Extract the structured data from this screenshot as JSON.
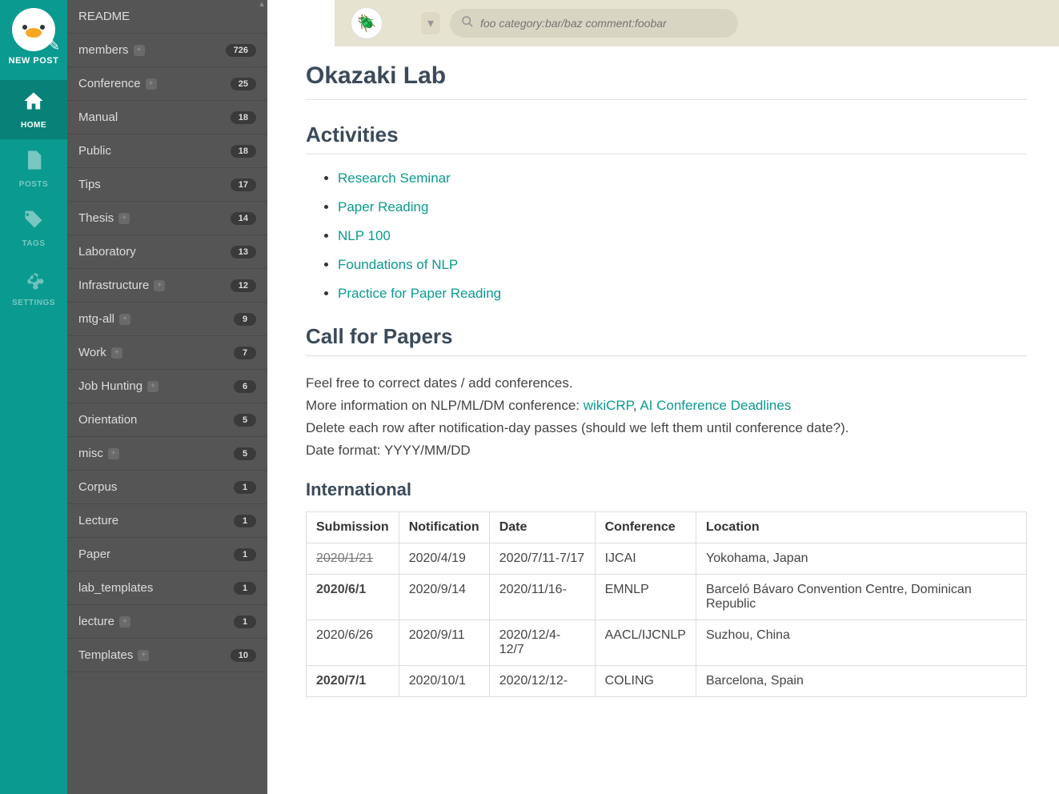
{
  "nav": {
    "new_post": "NEW POST",
    "items": [
      {
        "label": "HOME",
        "icon": "home",
        "active": true
      },
      {
        "label": "POSTS",
        "icon": "file",
        "active": false
      },
      {
        "label": "TAGS",
        "icon": "tags",
        "active": false
      },
      {
        "label": "SETTINGS",
        "icon": "gear",
        "active": false
      }
    ]
  },
  "search": {
    "placeholder": "foo category:bar/baz comment:foobar"
  },
  "categories": [
    {
      "name": "README",
      "count": null,
      "plus": false
    },
    {
      "name": "members",
      "count": "726",
      "plus": true
    },
    {
      "name": "Conference",
      "count": "25",
      "plus": true
    },
    {
      "name": "Manual",
      "count": "18",
      "plus": false
    },
    {
      "name": "Public",
      "count": "18",
      "plus": false
    },
    {
      "name": "Tips",
      "count": "17",
      "plus": false
    },
    {
      "name": "Thesis",
      "count": "14",
      "plus": true
    },
    {
      "name": "Laboratory",
      "count": "13",
      "plus": false
    },
    {
      "name": "Infrastructure",
      "count": "12",
      "plus": true
    },
    {
      "name": "mtg-all",
      "count": "9",
      "plus": true
    },
    {
      "name": "Work",
      "count": "7",
      "plus": true
    },
    {
      "name": "Job Hunting",
      "count": "6",
      "plus": true
    },
    {
      "name": "Orientation",
      "count": "5",
      "plus": false
    },
    {
      "name": "misc",
      "count": "5",
      "plus": true
    },
    {
      "name": "Corpus",
      "count": "1",
      "plus": false
    },
    {
      "name": "Lecture",
      "count": "1",
      "plus": false
    },
    {
      "name": "Paper",
      "count": "1",
      "plus": false
    },
    {
      "name": "lab_templates",
      "count": "1",
      "plus": false
    },
    {
      "name": "lecture",
      "count": "1",
      "plus": true
    },
    {
      "name": "Templates",
      "count": "10",
      "plus": true
    }
  ],
  "page": {
    "title": "Okazaki Lab",
    "activities_heading": "Activities",
    "activities": [
      "Research Seminar",
      "Paper Reading",
      "NLP 100",
      "Foundations of NLP",
      "Practice for Paper Reading"
    ],
    "cfp_heading": "Call for Papers",
    "cfp_line1": "Feel free to correct dates / add conferences.",
    "cfp_line2_a": "More information on NLP/ML/DM conference: ",
    "cfp_link1": "wikiCRP",
    "cfp_sep": ", ",
    "cfp_link2": "AI Conference Deadlines",
    "cfp_line3": "Delete each row after notification-day passes (should we left them until conference date?).",
    "cfp_line4": "Date format: YYYY/MM/DD",
    "intl_heading": "International",
    "table": {
      "headers": [
        "Submission",
        "Notification",
        "Date",
        "Conference",
        "Location"
      ],
      "rows": [
        {
          "submission": "2020/1/21",
          "sub_style": "strike",
          "notification": "2020/4/19",
          "date": "2020/7/11-7/17",
          "conf": "IJCAI",
          "loc": "Yokohama, Japan"
        },
        {
          "submission": "2020/6/1",
          "sub_style": "bold",
          "notification": "2020/9/14",
          "date": "2020/11/16-",
          "conf": "EMNLP",
          "loc": "Barceló Bávaro Convention Centre, Dominican Republic"
        },
        {
          "submission": "2020/6/26",
          "sub_style": "",
          "notification": "2020/9/11",
          "date": "2020/12/4-12/7",
          "conf": "AACL/IJCNLP",
          "loc": "Suzhou, China"
        },
        {
          "submission": "2020/7/1",
          "sub_style": "bold",
          "notification": "2020/10/1",
          "date": "2020/12/12-",
          "conf": "COLING",
          "loc": "Barcelona, Spain"
        }
      ]
    }
  }
}
